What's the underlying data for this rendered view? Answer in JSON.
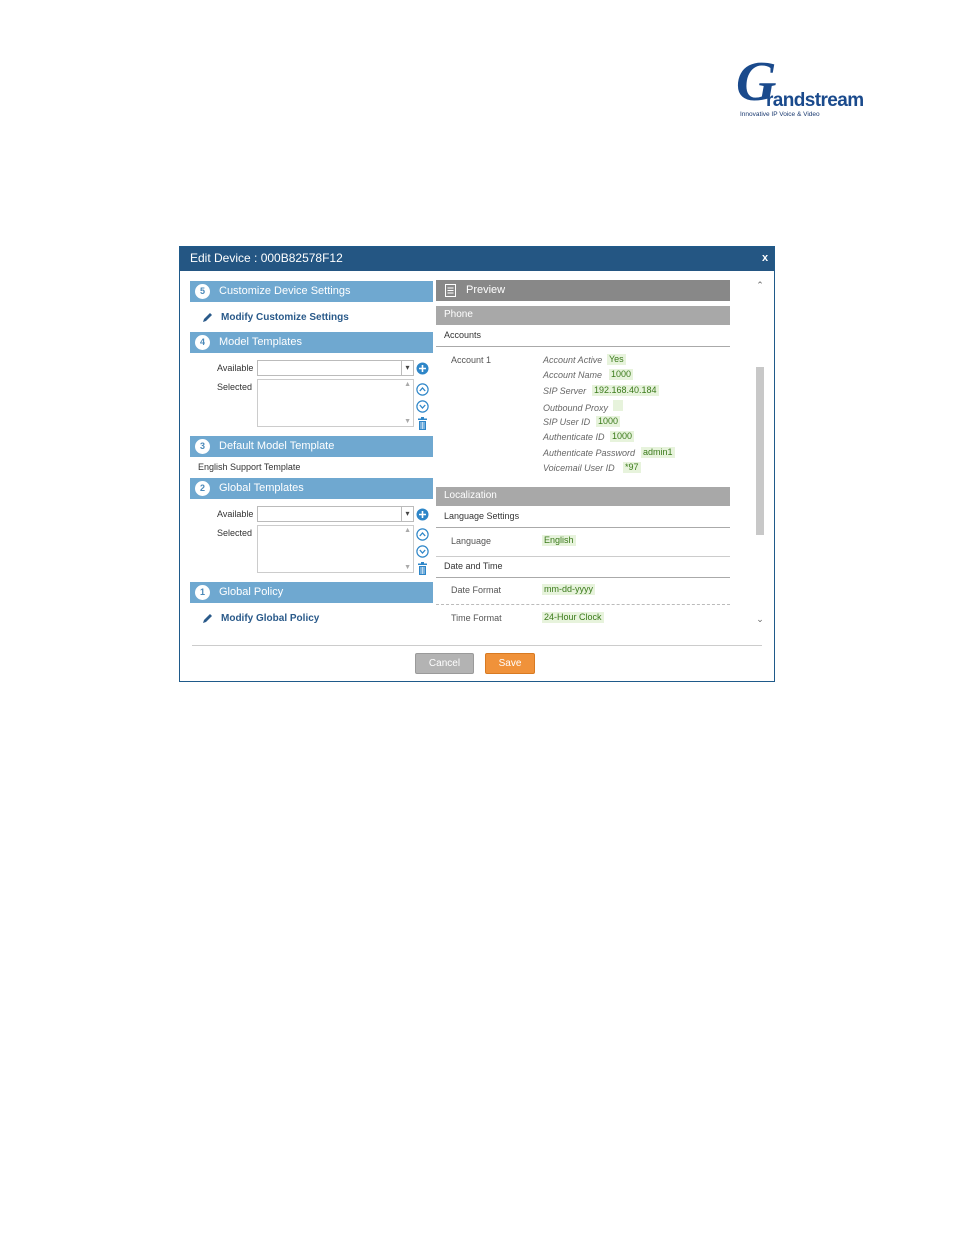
{
  "logo": {
    "letter": "G",
    "word": "randstream",
    "tagline": "Innovative IP Voice & Video"
  },
  "dialog": {
    "title": "Edit Device : 000B82578F12",
    "close": "x",
    "left": {
      "sections": [
        {
          "num": "5",
          "label": "Customize Device Settings"
        },
        {
          "num": "4",
          "label": "Model Templates"
        },
        {
          "num": "3",
          "label": "Default Model Template"
        },
        {
          "num": "2",
          "label": "Global Templates"
        },
        {
          "num": "1",
          "label": "Global Policy"
        }
      ],
      "modify_customize": "Modify Customize Settings",
      "available_label": "Available",
      "selected_label": "Selected",
      "default_template_value": "English Support Template",
      "modify_global": "Modify Global Policy"
    },
    "preview": {
      "header": "Preview",
      "phone": "Phone",
      "accounts": "Accounts",
      "account_row": "Account 1",
      "fields": [
        {
          "key": "Account Active",
          "value": "Yes"
        },
        {
          "key": "Account Name",
          "value": "1000"
        },
        {
          "key": "SIP Server",
          "value": "192.168.40.184"
        },
        {
          "key": "Outbound Proxy",
          "value": ""
        },
        {
          "key": "SIP User ID",
          "value": "1000"
        },
        {
          "key": "Authenticate ID",
          "value": "1000"
        },
        {
          "key": "Authenticate Password",
          "value": "admin1"
        },
        {
          "key": "Voicemail User ID",
          "value": "*97"
        }
      ],
      "localization": "Localization",
      "language_settings": "Language Settings",
      "language_label": "Language",
      "language_value": "English",
      "date_time": "Date and Time",
      "date_format_label": "Date Format",
      "date_format_value": "mm-dd-yyyy",
      "time_format_label": "Time Format",
      "time_format_value": "24-Hour Clock"
    },
    "buttons": {
      "cancel": "Cancel",
      "save": "Save"
    }
  },
  "colors": {
    "titlebar": "#245683",
    "section": "#6fa8d0",
    "preview_header": "#888888",
    "save": "#f0923a",
    "value_text": "#3a7a1a"
  }
}
